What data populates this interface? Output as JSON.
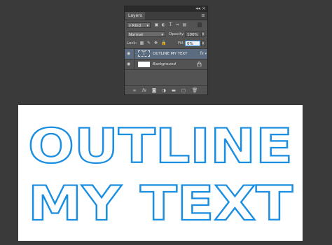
{
  "panel": {
    "tab_label": "Layers",
    "collapse_glyph": "◂◂",
    "close_glyph": "×",
    "menu_glyph": "≡",
    "filter": {
      "label": "Kind",
      "prefix": "⌕"
    },
    "blend_mode": "Normal",
    "opacity_label": "Opacity:",
    "opacity_value": "100%",
    "lock_label": "Lock:",
    "fill_label": "Fill:",
    "fill_value": "0%",
    "layers": [
      {
        "name": "OUTLINE MY TEXT",
        "thumb": "T",
        "fx": "fx"
      },
      {
        "name": "Background"
      }
    ],
    "bottom_icons": [
      "link-icon",
      "fx-icon",
      "mask-icon",
      "adjustment-icon",
      "group-folder-icon",
      "new-layer-icon",
      "delete-icon"
    ]
  },
  "canvas": {
    "line1": "OUTLINE",
    "line2": "MY TEXT",
    "stroke_color": "#1a8ee0"
  }
}
